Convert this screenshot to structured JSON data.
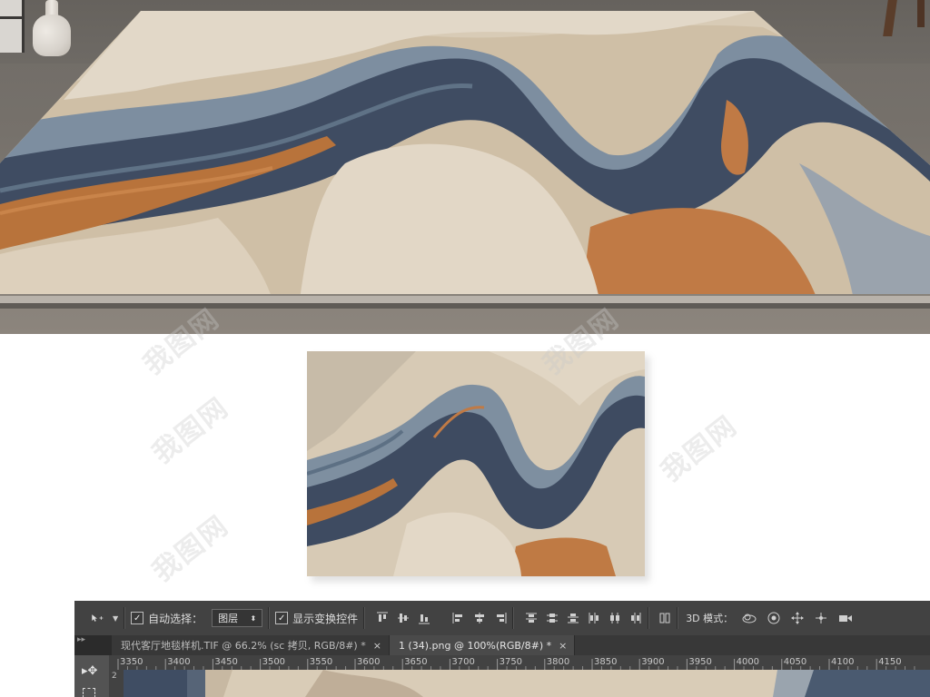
{
  "watermark": {
    "text": "我图网"
  },
  "photoshop": {
    "options": {
      "auto_select_label": "自动选择：",
      "auto_select_value": "图层",
      "show_transform_label": "显示变换控件",
      "mode_3d_label": "3D 模式："
    },
    "tabs": [
      {
        "label": "现代客厅地毯样机.TIF @ 66.2% (sc 拷贝, RGB/8#) *",
        "close": "×"
      },
      {
        "label": "1 (34).png @ 100%(RGB/8#) *",
        "close": "×"
      }
    ],
    "ruler": {
      "ticks": [
        "3350",
        "3400",
        "3450",
        "3500",
        "3550",
        "3600",
        "3650",
        "3700",
        "3750",
        "3800",
        "3850",
        "3900",
        "3950",
        "4000",
        "4050",
        "4100",
        "4150"
      ]
    },
    "vruler": {
      "label": "2"
    }
  },
  "colors": {
    "beige": "#d9ccb8",
    "sand": "#c7b39a",
    "navy": "#3e4b60",
    "blue_grey": "#6f8397",
    "orange": "#b8733b",
    "floor": "#7a756f"
  }
}
